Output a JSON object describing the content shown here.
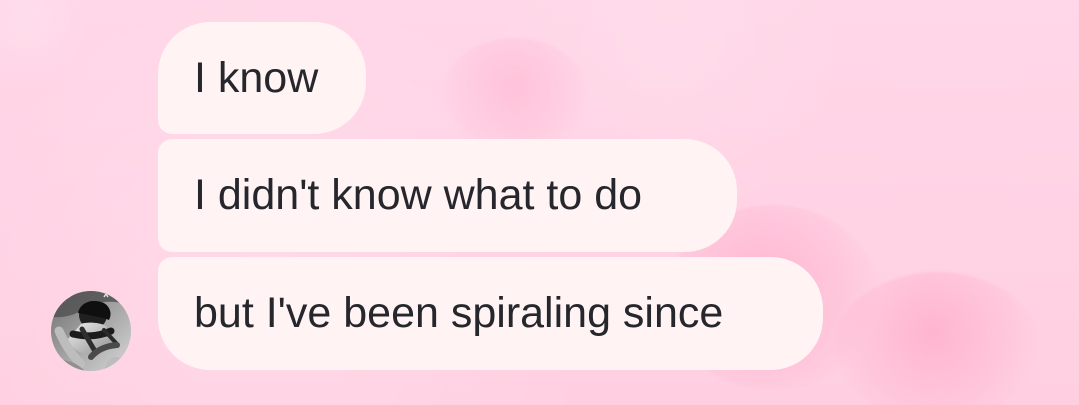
{
  "chat": {
    "messages": [
      {
        "text": "I know"
      },
      {
        "text": "I didn't know what to do"
      },
      {
        "text": "but I've been spiraling since"
      }
    ]
  },
  "ui": {
    "avatar_icon": "user-avatar",
    "colors": {
      "background": "#ffd3e4",
      "bubble": "#fff3f4",
      "text": "#25272c"
    }
  }
}
